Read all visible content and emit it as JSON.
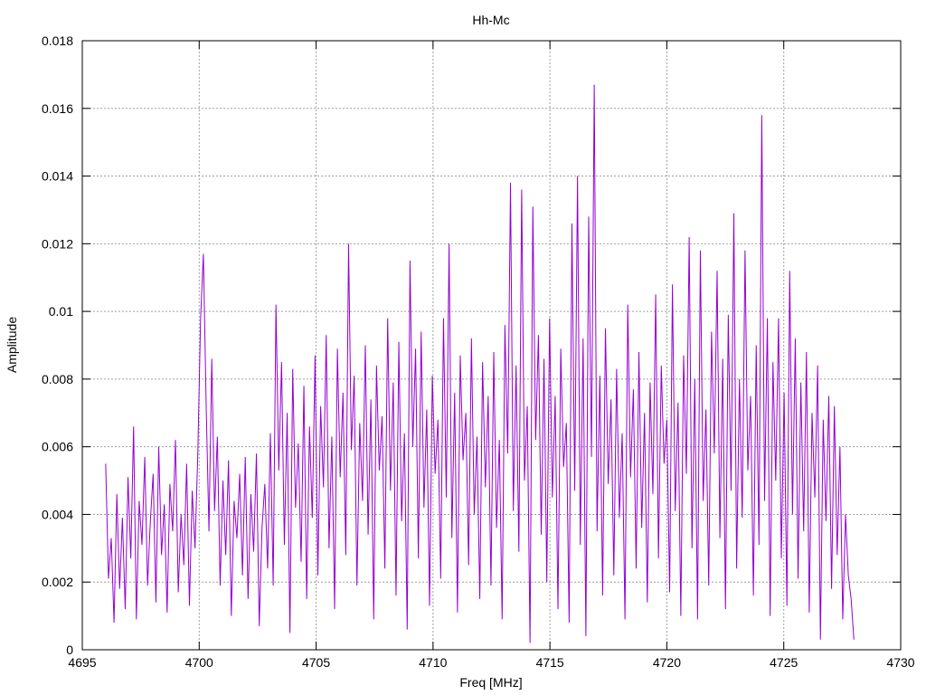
{
  "colors": {
    "series": "#9400d3",
    "grid": "#a0a0a0",
    "axis": "#000000",
    "background": "#ffffff"
  },
  "chart_data": {
    "type": "line",
    "title": "Hh-Mc",
    "xlabel": "Freq [MHz]",
    "ylabel": "Amplitude",
    "xlim": [
      4695,
      4730
    ],
    "ylim": [
      0,
      0.018
    ],
    "x_ticks": [
      4695,
      4700,
      4705,
      4710,
      4715,
      4720,
      4725,
      4730
    ],
    "x_tick_labels": [
      "4695",
      "4700",
      "4705",
      "4710",
      "4715",
      "4720",
      "4725",
      "4730"
    ],
    "y_ticks": [
      0,
      0.002,
      0.004,
      0.006,
      0.008,
      0.01,
      0.012,
      0.014,
      0.016,
      0.018
    ],
    "y_tick_labels": [
      "0",
      "0.002",
      "0.004",
      "0.006",
      "0.008",
      "0.01",
      "0.012",
      "0.014",
      "0.016",
      "0.018"
    ],
    "grid": true,
    "legend": "none",
    "series": [
      {
        "x_start": 4696.0,
        "x_end": 4728.0,
        "envelope_x": [
          4696.0,
          4697.0,
          4698.3,
          4699.0,
          4700.0,
          4701.0,
          4702.8,
          4704.0,
          4705.0,
          4706.7,
          4708.0,
          4709.4,
          4710.0,
          4710.4,
          4712.4,
          4713.2,
          4714.0,
          4715.0,
          4716.0,
          4718.0,
          4719.0,
          4720.0,
          4721.3,
          4722.0,
          4723.1,
          4724.0,
          4725.0,
          4726.5,
          4727.0,
          4727.6,
          4728.0
        ],
        "envelope_upper": [
          0.0055,
          0.006,
          0.0117,
          0.006,
          0.0065,
          0.0102,
          0.012,
          0.0098,
          0.0115,
          0.012,
          0.0102,
          0.0138,
          0.0136,
          0.0131,
          0.014,
          0.0167,
          0.0105,
          0.0102,
          0.0108,
          0.0122,
          0.0118,
          0.0112,
          0.0129,
          0.0118,
          0.0158,
          0.0098,
          0.0112,
          0.0088,
          0.0075,
          0.0072,
          0.0015
        ],
        "envelope_lower": [
          0.002,
          0.0008,
          0.001,
          0.0006,
          0.0008,
          0.0005,
          0.001,
          0.0008,
          0.0004,
          0.0008,
          0.0007,
          0.0008,
          0.0002,
          0.0005,
          0.0008,
          0.0004,
          0.0009,
          0.001,
          0.0009,
          0.0008,
          0.0009,
          0.001,
          0.0011,
          0.001,
          0.001,
          0.0011,
          0.001,
          0.0003,
          0.0008,
          0.0009,
          0.0003
        ],
        "values": [
          0.0055,
          0.0021,
          0.0033,
          0.0008,
          0.0046,
          0.0018,
          0.0039,
          0.0012,
          0.0051,
          0.0027,
          0.0066,
          0.0009,
          0.0044,
          0.0031,
          0.0057,
          0.0019,
          0.0038,
          0.0052,
          0.0014,
          0.006,
          0.0028,
          0.0043,
          0.0011,
          0.0049,
          0.0035,
          0.0062,
          0.0017,
          0.004,
          0.0025,
          0.0055,
          0.0013,
          0.0047,
          0.003,
          0.0058,
          0.0098,
          0.0117,
          0.0072,
          0.0035,
          0.0086,
          0.0041,
          0.0063,
          0.0019,
          0.005,
          0.0028,
          0.0056,
          0.001,
          0.0044,
          0.0033,
          0.0052,
          0.0022,
          0.0057,
          0.0015,
          0.0046,
          0.0029,
          0.0058,
          0.0007,
          0.0036,
          0.0049,
          0.0024,
          0.0064,
          0.0019,
          0.0102,
          0.0053,
          0.0085,
          0.0031,
          0.007,
          0.0005,
          0.0083,
          0.0042,
          0.0061,
          0.0026,
          0.0078,
          0.0015,
          0.0066,
          0.0039,
          0.0087,
          0.0022,
          0.0072,
          0.0048,
          0.0093,
          0.003,
          0.0063,
          0.0012,
          0.0089,
          0.0051,
          0.0076,
          0.0028,
          0.012,
          0.0059,
          0.0081,
          0.0019,
          0.0067,
          0.0044,
          0.009,
          0.0034,
          0.0074,
          0.0009,
          0.0084,
          0.0053,
          0.0069,
          0.0024,
          0.0098,
          0.0047,
          0.0079,
          0.0016,
          0.0091,
          0.0038,
          0.0064,
          0.0006,
          0.0115,
          0.006,
          0.0089,
          0.0027,
          0.0094,
          0.0042,
          0.0071,
          0.0013,
          0.0081,
          0.0052,
          0.0068,
          0.0021,
          0.0098,
          0.0045,
          0.012,
          0.0033,
          0.0076,
          0.0011,
          0.0087,
          0.0056,
          0.007,
          0.0025,
          0.0092,
          0.004,
          0.0063,
          0.0015,
          0.0085,
          0.0048,
          0.0075,
          0.0019,
          0.0088,
          0.0036,
          0.0062,
          0.0009,
          0.0096,
          0.0058,
          0.0138,
          0.0041,
          0.0084,
          0.0029,
          0.0136,
          0.005,
          0.0072,
          0.0002,
          0.0131,
          0.0062,
          0.0093,
          0.0034,
          0.0086,
          0.002,
          0.0098,
          0.0045,
          0.0075,
          0.0012,
          0.0089,
          0.0054,
          0.0067,
          0.0008,
          0.0126,
          0.0047,
          0.014,
          0.0031,
          0.0092,
          0.0004,
          0.0128,
          0.0057,
          0.0167,
          0.0035,
          0.0081,
          0.0016,
          0.0095,
          0.0049,
          0.0074,
          0.0022,
          0.0083,
          0.0039,
          0.0064,
          0.0009,
          0.0102,
          0.0051,
          0.0077,
          0.0024,
          0.0088,
          0.0036,
          0.007,
          0.0014,
          0.0079,
          0.0046,
          0.0105,
          0.0027,
          0.0084,
          0.0055,
          0.0068,
          0.0017,
          0.0108,
          0.0041,
          0.0073,
          0.001,
          0.0087,
          0.0052,
          0.0122,
          0.003,
          0.008,
          0.0009,
          0.0118,
          0.0044,
          0.0071,
          0.0019,
          0.0094,
          0.0058,
          0.0112,
          0.0033,
          0.0086,
          0.0012,
          0.0099,
          0.0047,
          0.0129,
          0.0024,
          0.008,
          0.0039,
          0.0118,
          0.0053,
          0.0075,
          0.0016,
          0.009,
          0.0031,
          0.0158,
          0.0044,
          0.0098,
          0.001,
          0.0085,
          0.005,
          0.0098,
          0.0027,
          0.0076,
          0.0013,
          0.0112,
          0.004,
          0.0092,
          0.0021,
          0.0079,
          0.0035,
          0.0088,
          0.0011,
          0.007,
          0.0045,
          0.0084,
          0.0003,
          0.0068,
          0.0038,
          0.0075,
          0.0018,
          0.0072,
          0.0028,
          0.006,
          0.0009,
          0.004,
          0.0022,
          0.0015,
          0.0003
        ]
      }
    ]
  }
}
